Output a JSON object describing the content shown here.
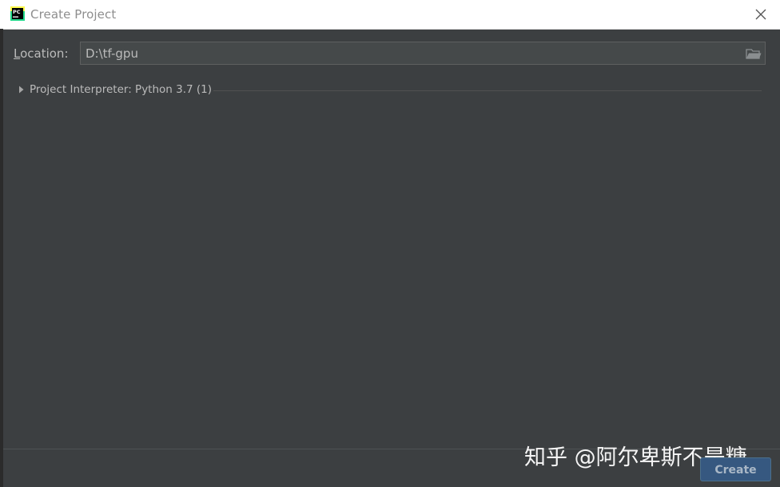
{
  "window": {
    "title": "Create Project",
    "app_icon": "pycharm-logo-icon",
    "close_icon": "close-icon"
  },
  "location": {
    "label": "Location:",
    "value": "D:\\tf-gpu",
    "browse_icon": "folder-icon"
  },
  "interpreter": {
    "label": "Project Interpreter: Python 3.7 (1)",
    "expand_icon": "triangle-right-icon"
  },
  "watermark": "知乎 @阿尔卑斯不是糖",
  "footer": {
    "create_label": "Create"
  },
  "colors": {
    "background": "#3c3f41",
    "titlebar": "#ffffff",
    "primary_button": "#365880",
    "text": "#bbbbbb"
  }
}
